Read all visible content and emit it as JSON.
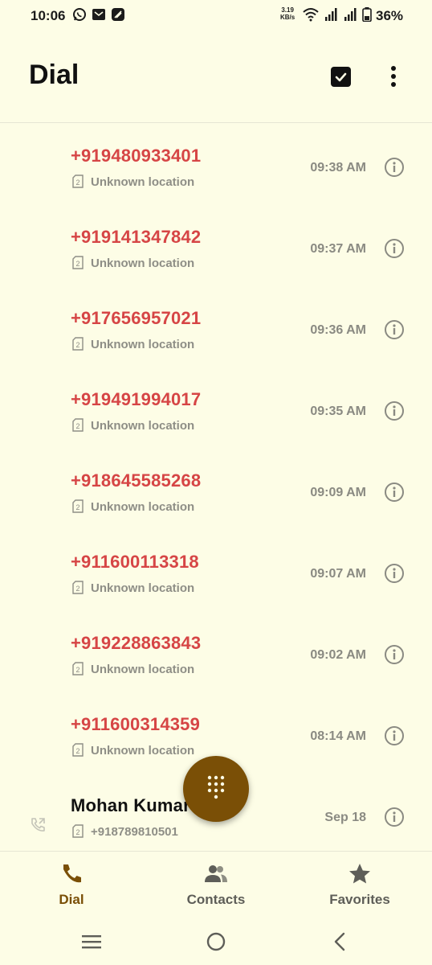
{
  "status_bar": {
    "time": "10:06",
    "speed_value": "3.19",
    "speed_unit": "KB/s",
    "battery": "36%"
  },
  "header": {
    "title": "Dial"
  },
  "calls": [
    {
      "number": "+919480933401",
      "location": "Unknown location",
      "time": "09:38 AM",
      "sim": "2"
    },
    {
      "number": "+919141347842",
      "location": "Unknown location",
      "time": "09:37 AM",
      "sim": "2"
    },
    {
      "number": "+917656957021",
      "location": "Unknown location",
      "time": "09:36 AM",
      "sim": "2"
    },
    {
      "number": "+919491994017",
      "location": "Unknown location",
      "time": "09:35 AM",
      "sim": "2"
    },
    {
      "number": "+918645585268",
      "location": "Unknown location",
      "time": "09:09 AM",
      "sim": "2"
    },
    {
      "number": "+911600113318",
      "location": "Unknown location",
      "time": "09:07 AM",
      "sim": "2"
    },
    {
      "number": "+919228863843",
      "location": "Unknown location",
      "time": "09:02 AM",
      "sim": "2"
    },
    {
      "number": "+911600314359",
      "location": "Unknown location",
      "time": "08:14 AM",
      "sim": "2"
    },
    {
      "number": "Mohan Kumar",
      "location": "+918789810501",
      "time": "Sep 18",
      "sim": "2"
    }
  ],
  "bottom_nav": {
    "dial": "Dial",
    "contacts": "Contacts",
    "favorites": "Favorites"
  },
  "colors": {
    "background": "#fdfde6",
    "missed_call": "#d64545",
    "accent": "#7a4f06"
  }
}
